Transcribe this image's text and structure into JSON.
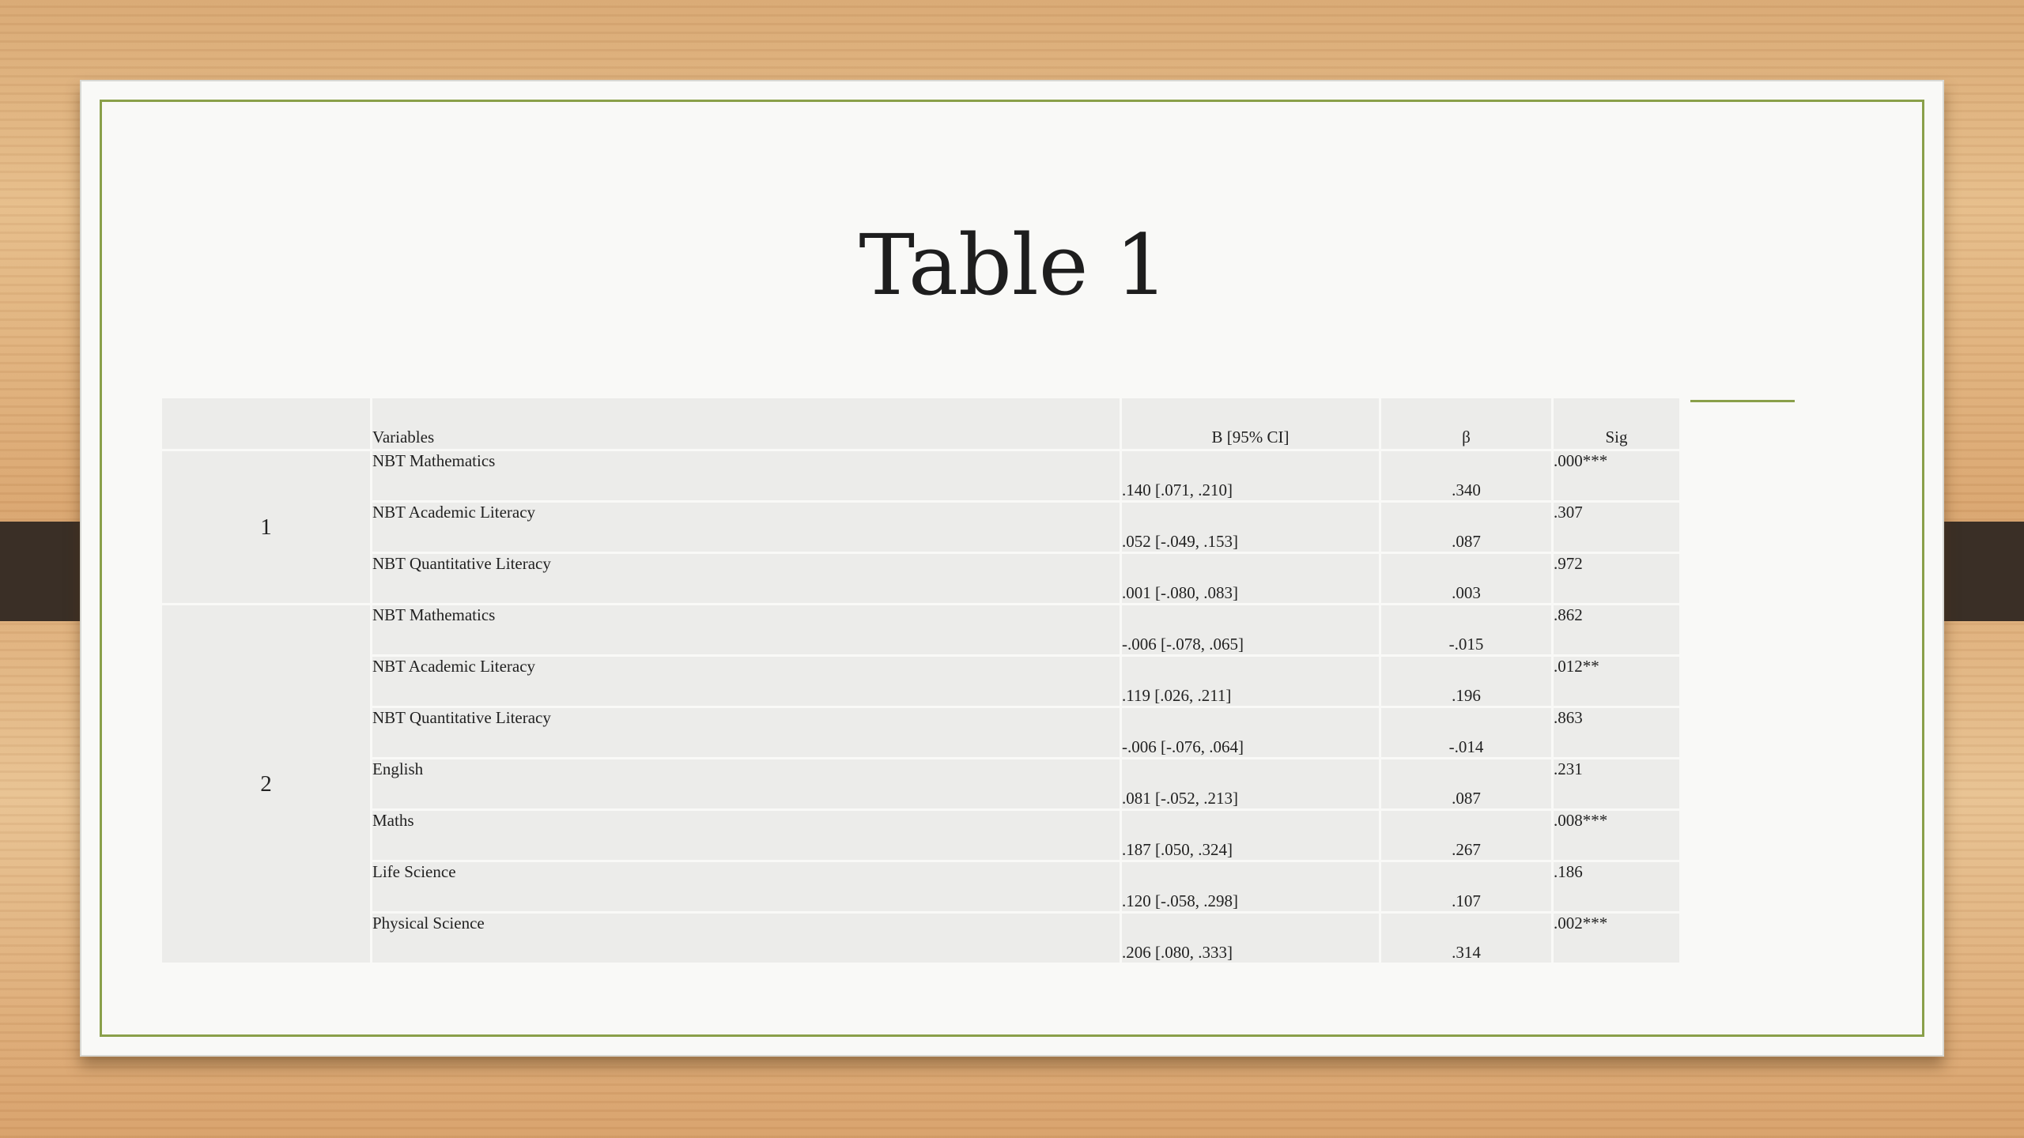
{
  "slide": {
    "title": "Table 1"
  },
  "table": {
    "headers": {
      "model": "",
      "variables": "Variables",
      "b_ci": "B [95% CI]",
      "beta": "β",
      "sig": "Sig"
    },
    "models": [
      {
        "label": "1",
        "rows": [
          {
            "variable": "NBT Mathematics",
            "b_ci": ".140 [.071, .210]",
            "beta": ".340",
            "sig": ".000***"
          },
          {
            "variable": "NBT Academic Literacy",
            "b_ci": ".052 [-.049, .153]",
            "beta": ".087",
            "sig": ".307"
          },
          {
            "variable": "NBT Quantitative Literacy",
            "b_ci": ".001 [-.080, .083]",
            "beta": ".003",
            "sig": ".972"
          }
        ]
      },
      {
        "label": "2",
        "rows": [
          {
            "variable": "NBT Mathematics",
            "b_ci": "-.006 [-.078, .065]",
            "beta": "-.015",
            "sig": ".862"
          },
          {
            "variable": "NBT Academic Literacy",
            "b_ci": ".119 [.026, .211]",
            "beta": ".196",
            "sig": ".012**"
          },
          {
            "variable": "NBT Quantitative Literacy",
            "b_ci": "-.006 [-.076, .064]",
            "beta": "-.014",
            "sig": ".863"
          },
          {
            "variable": "English",
            "b_ci": ".081 [-.052, .213]",
            "beta": ".087",
            "sig": ".231"
          },
          {
            "variable": "Maths",
            "b_ci": ".187 [.050, .324]",
            "beta": ".267",
            "sig": ".008***"
          },
          {
            "variable": "Life Science",
            "b_ci": ".120 [-.058, .298]",
            "beta": ".107",
            "sig": ".186"
          },
          {
            "variable": "Physical Science",
            "b_ci": ".206 [.080, .333]",
            "beta": ".314",
            "sig": ".002***"
          }
        ]
      }
    ]
  },
  "colors": {
    "frame_accent": "#8aa04a",
    "cell_background": "#ececea",
    "slide_background": "#f9f9f7"
  }
}
